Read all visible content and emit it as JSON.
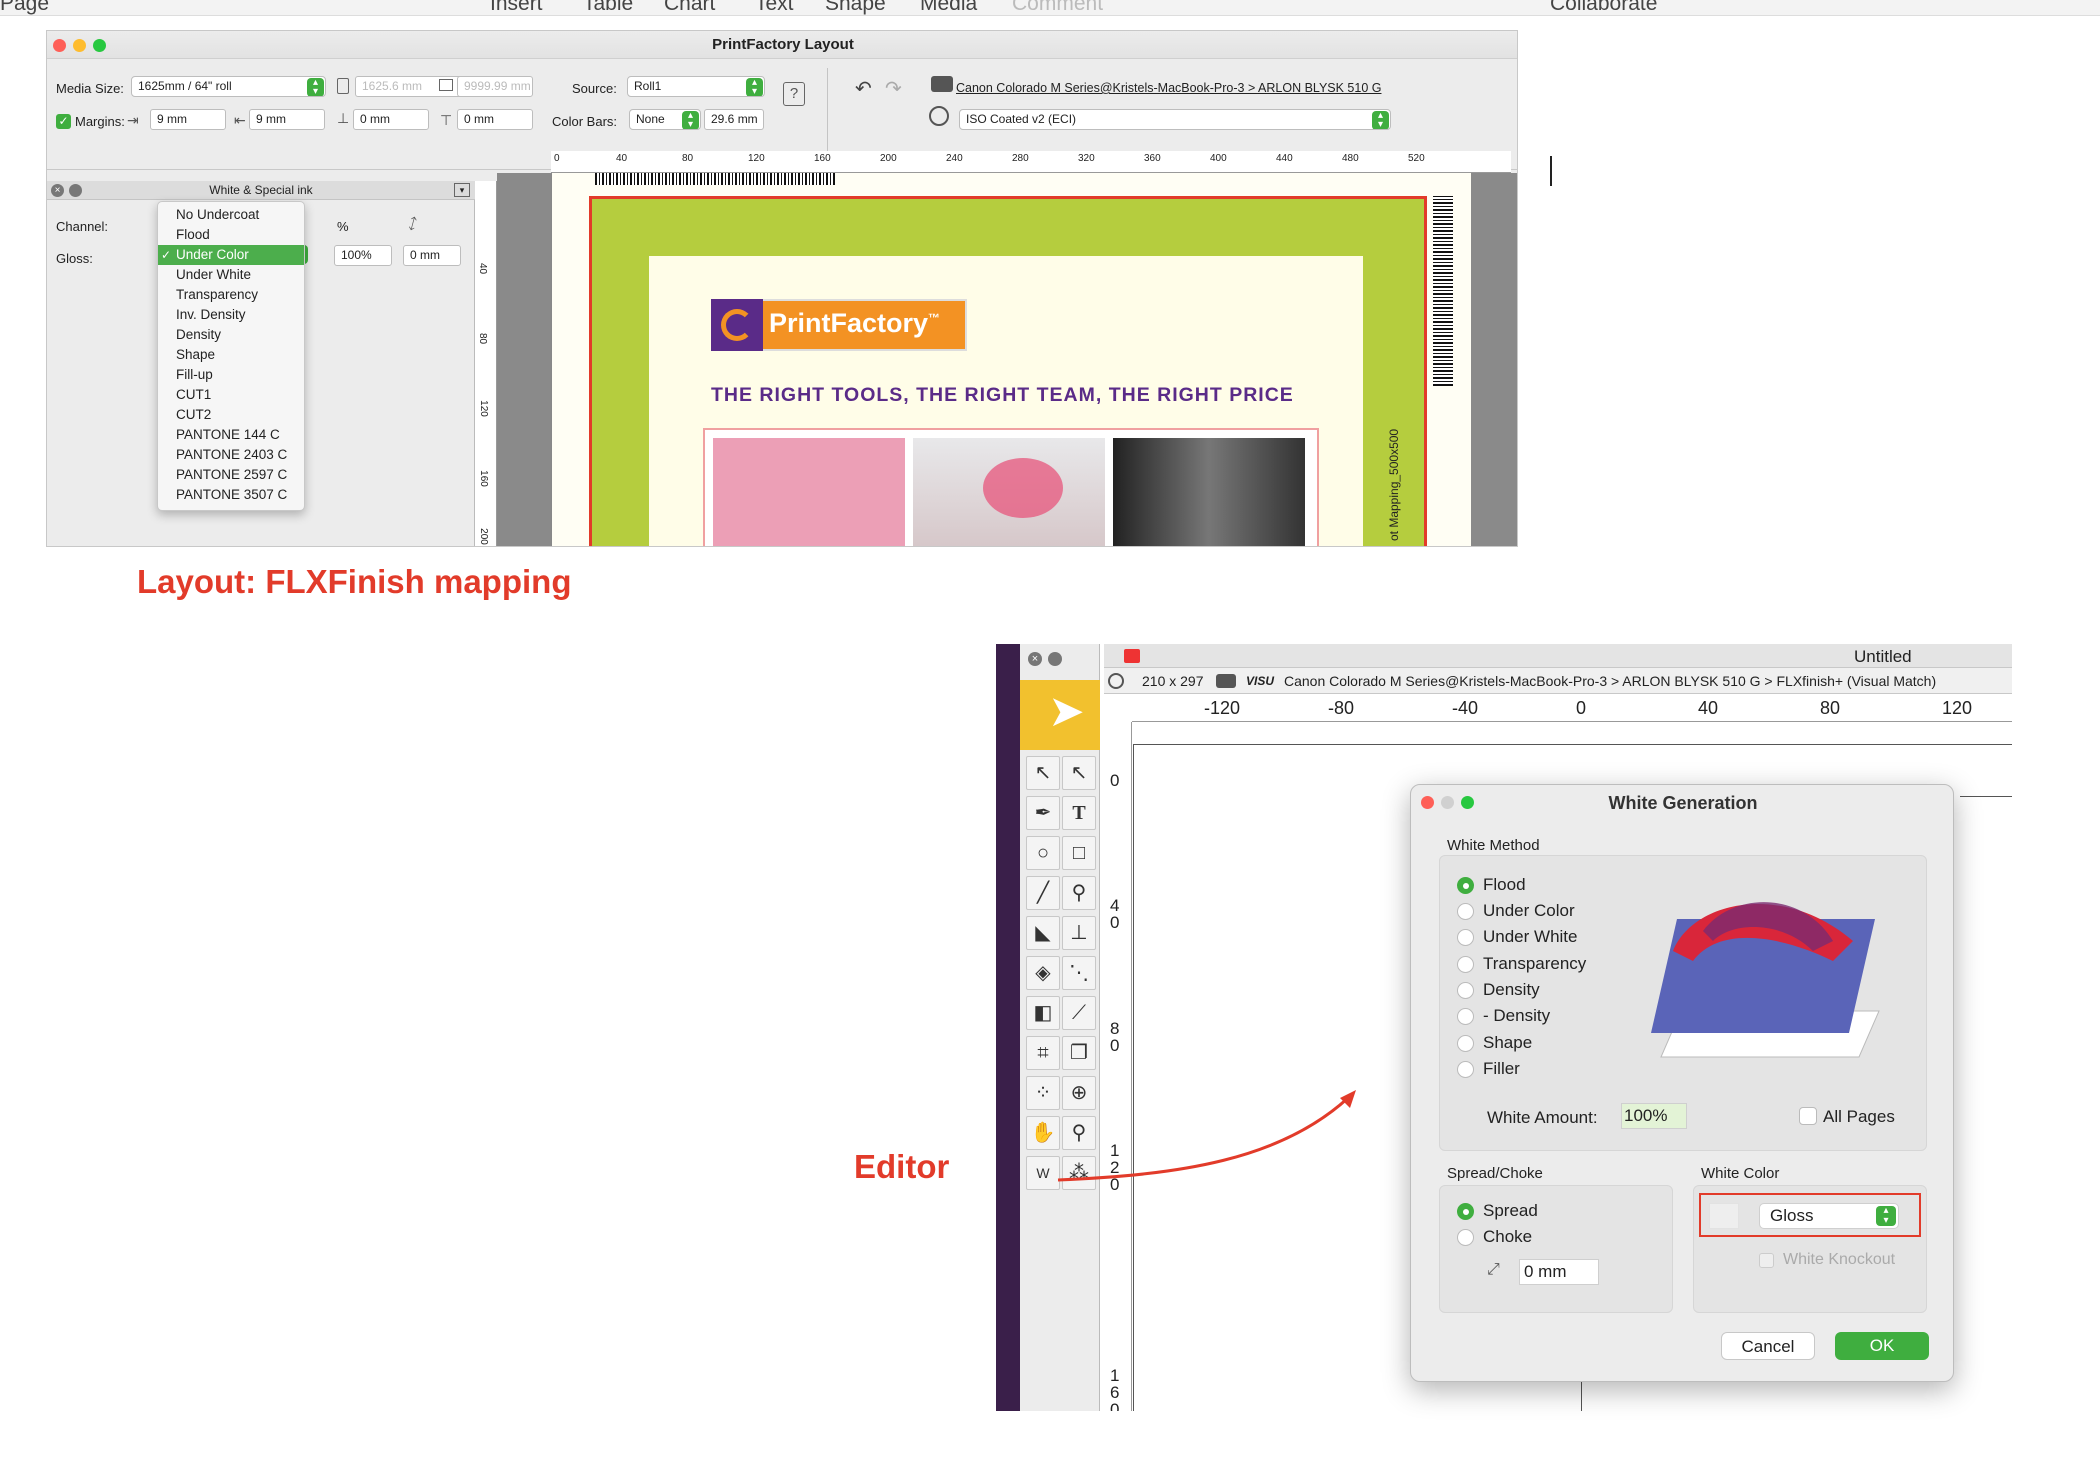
{
  "top_menu": [
    "Page",
    "Insert",
    "Table",
    "Chart",
    "Text",
    "Shape",
    "Media",
    "Comment",
    "Collaborate"
  ],
  "layout_window": {
    "title": "PrintFactory Layout",
    "media_size_label": "Media Size:",
    "media_size_value": "1625mm / 64\" roll",
    "media_width": "1625.6 mm",
    "media_length": "9999.99 mm",
    "source_label": "Source:",
    "source_value": "Roll1",
    "printer_path": "Canon Colorado M Series@Kristels-MacBook-Pro-3 > ARLON BLYSK 510 G",
    "margins_label": "Margins:",
    "margin_left": "9 mm",
    "margin_right": "9 mm",
    "margin_bottom": "0 mm",
    "margin_top": "0 mm",
    "color_bars_label": "Color Bars:",
    "color_bars_value": "None",
    "color_bars_size": "29.6 mm",
    "profile_value": "ISO Coated v2 (ECI)",
    "panel_title": "White & Special ink",
    "channel_label": "Channel:",
    "gloss_label": "Gloss:",
    "percent_header": "%",
    "gloss_percent": "100%",
    "gloss_spread": "0 mm",
    "dropdown_items": [
      "No Undercoat",
      "Flood",
      "Under Color",
      "Under White",
      "Transparency",
      "Inv. Density",
      "Density",
      "Shape",
      "Fill-up",
      "CUT1",
      "CUT2",
      "PANTONE 144 C",
      "PANTONE 2403 C",
      "PANTONE 2597 C",
      "PANTONE 3507 C"
    ],
    "dropdown_selected": "Under Color",
    "ruler_h": [
      "0",
      "40",
      "80",
      "120",
      "160",
      "200",
      "240",
      "280",
      "320",
      "360",
      "400",
      "440",
      "480",
      "520"
    ],
    "ruler_v": [
      "40",
      "80",
      "120",
      "160",
      "200"
    ],
    "artwork_logo_text": "PrintFactory",
    "artwork_logo_tm": "™",
    "artwork_tagline": "THE RIGHT TOOLS, THE RIGHT TEAM, THE RIGHT PRICE",
    "artwork_side_text": "ot Mapping_500x500"
  },
  "caption_layout": "Layout:  FLXFinish mapping",
  "caption_editor": "Editor",
  "editor_window": {
    "title": "Untitled",
    "doc_size": "210 x 297",
    "printer_path": "Canon Colorado M Series@Kristels-MacBook-Pro-3 > ARLON BLYSK 510 G > FLXfinish+ (Visual Match)",
    "visu_label": "VISU",
    "ruler_h": [
      "-120",
      "-80",
      "-40",
      "0",
      "40",
      "80",
      "120"
    ],
    "ruler_v": [
      "0",
      "40",
      "80",
      "120",
      "160"
    ]
  },
  "dialog": {
    "title": "White Generation",
    "white_method_label": "White Method",
    "methods": [
      "Flood",
      "Under Color",
      "Under White",
      "Transparency",
      "Density",
      "- Density",
      "Shape",
      "Filler"
    ],
    "selected_method": "Flood",
    "white_amount_label": "White Amount:",
    "white_amount_value": "100%",
    "all_pages_label": "All Pages",
    "spread_choke_label": "Spread/Choke",
    "spread_label": "Spread",
    "choke_label": "Choke",
    "spread_value": "0 mm",
    "white_color_label": "White Color",
    "white_color_value": "Gloss",
    "white_knockout_label": "White Knockout",
    "cancel_label": "Cancel",
    "ok_label": "OK"
  },
  "colors": {
    "accent_green": "#3fae3f",
    "annotation_red": "#e23b2a",
    "brand_purple": "#5a2b88",
    "brand_orange": "#f39223"
  }
}
